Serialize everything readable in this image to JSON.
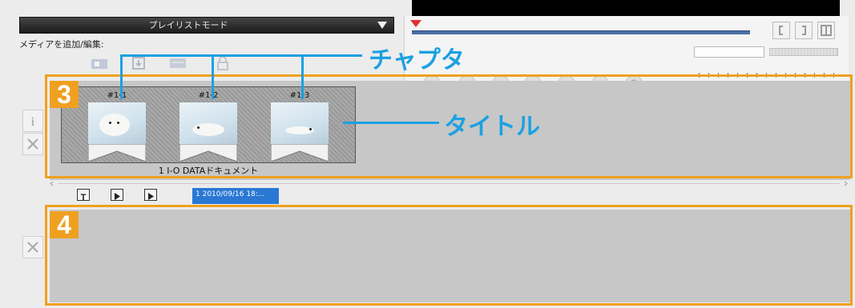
{
  "playlist": {
    "mode_label": "プレイリストモード",
    "media_label": "メディアを追加/編集:"
  },
  "chapters": [
    {
      "label": "#1-1"
    },
    {
      "label": "#1-2"
    },
    {
      "label": "#1-3"
    }
  ],
  "title_name": "1 I-O DATAドキュメント",
  "timeline": {
    "timestamp": "1 2010/09/16 18:..."
  },
  "annotations": {
    "chapter": "チャプタ",
    "title": "タイトル",
    "badge3": "3",
    "badge4": "4"
  },
  "colors": {
    "accent_orange": "#f0a020",
    "annotation_blue": "#1ba1e2",
    "seek_blue": "#4a6ea4",
    "selected_blue": "#2a78d4"
  }
}
